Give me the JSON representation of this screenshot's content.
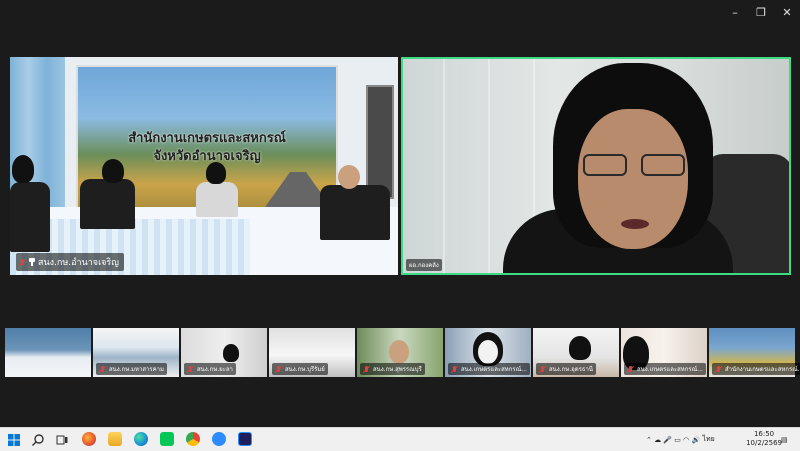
{
  "window_controls": {
    "minimize": "–",
    "restore": "❐",
    "close": "✕"
  },
  "main_tiles": [
    {
      "name": "สนง.กษ.อำนาจเจริญ"
    },
    {
      "name": "ผอ.กองคลัง"
    }
  ],
  "banner": {
    "line1": "สำนักงานเกษตรและสหกรณ์",
    "line2": "จังหวัดอำนาจเจริญ"
  },
  "thumbnails": [
    {
      "name": ""
    },
    {
      "name": "สนง.กษ.มหาสารคาม"
    },
    {
      "name": "สนง.กษ.ยะลา"
    },
    {
      "name": "สนง.กษ.บุรีรัมย์"
    },
    {
      "name": "สนง.กษ.สุพรรณบุรี"
    },
    {
      "name": "สนง.เกษตรและสหกรณ์..."
    },
    {
      "name": "สนง.กษ.อุดรธานี"
    },
    {
      "name": "สนง.เกษตรและสหกรณ์..."
    },
    {
      "name": "สำนักงานเกษตรและสหกรณ์..."
    }
  ],
  "taskbar": {
    "language": "ไทย",
    "time": "16:50",
    "date": "10/2/2569",
    "icons": [
      "windows-start-icon",
      "search-icon",
      "task-view-icon",
      "firefox-icon",
      "file-explorer-icon",
      "edge-icon",
      "line-icon",
      "chrome-icon",
      "zoom-icon",
      "zoom-workplace-icon"
    ]
  },
  "colors": {
    "active_speaker_border": "#3ddc84",
    "mic_muted": "#e04040"
  }
}
